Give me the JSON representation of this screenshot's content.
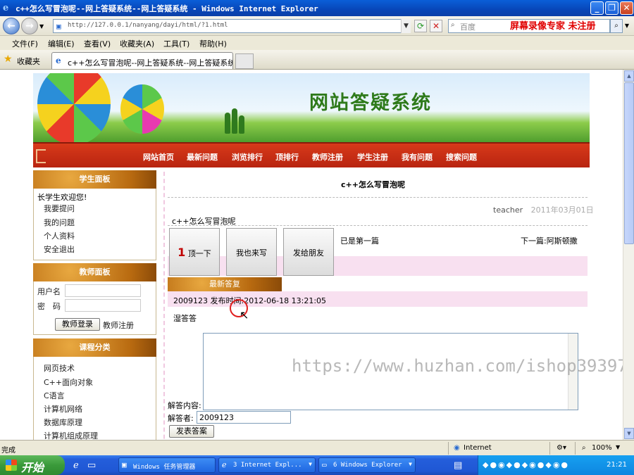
{
  "window": {
    "title": "c++怎么写冒泡呢--网上答疑系统--网上答疑系统 - Windows Internet Explorer",
    "min": "_",
    "max": "❐",
    "close": "✕"
  },
  "address": {
    "url": "http://127.0.0.1/nanyang/dayi/html/?1.html",
    "search_placeholder": "百度",
    "watermark": "屏幕录像专家 未注册"
  },
  "menu": {
    "items": [
      "文件(F)",
      "编辑(E)",
      "查看(V)",
      "收藏夹(A)",
      "工具(T)",
      "帮助(H)"
    ]
  },
  "favorites": {
    "label": "收藏夹",
    "tab_title": "c++怎么写冒泡呢--网上答疑系统--网上答疑系统"
  },
  "site": {
    "banner_title": "网站答疑系统",
    "nav": [
      "网站首页",
      "最新问题",
      "浏览排行",
      "顶排行",
      "教师注册",
      "学生注册",
      "我有问题",
      "搜索问题"
    ]
  },
  "student_panel": {
    "title": "学生面板",
    "welcome": "长学生欢迎您!",
    "links": [
      "我要提问",
      "我的问题",
      "个人资料",
      "安全退出"
    ]
  },
  "teacher_panel": {
    "title": "教师面板",
    "username_label": "用户名",
    "password_label": "密　码",
    "login_button": "教师登录",
    "register_link": "教师注册"
  },
  "course_panel": {
    "title": "课程分类",
    "items": [
      "网页技术",
      "C++面向对象",
      "C语言",
      "计算机网络",
      "数据库原理",
      "计算机组成原理"
    ]
  },
  "post": {
    "title": "c++怎么写冒泡呢",
    "author": "teacher",
    "date": "2011年03月01日",
    "content": "c++怎么写冒泡呢",
    "upvote_count": "1",
    "upvote_label": "顶一下",
    "write_too": "我也来写",
    "share": "发给朋友",
    "prev": "已是第一篇",
    "next": "下一篇:阿斯顿撒"
  },
  "replies": {
    "header": "最新答复",
    "items": [
      {
        "user": "2009123",
        "time_label": "发布时间:",
        "time": "2012-06-18 13:21:05",
        "text": "湿答答"
      }
    ],
    "content_label": "解答内容:",
    "replier_label": "解答者:",
    "replier_value": "2009123",
    "submit": "发表答案"
  },
  "watermark": "https://www.huzhan.com/ishop39397",
  "status": {
    "text": "完成",
    "zone": "Internet",
    "zoom": "100%"
  },
  "taskbar": {
    "start": "开始",
    "tasks": [
      "Windows 任务管理器",
      "3 Internet Expl...",
      "6 Windows Explorer"
    ],
    "clock": "21:21"
  }
}
